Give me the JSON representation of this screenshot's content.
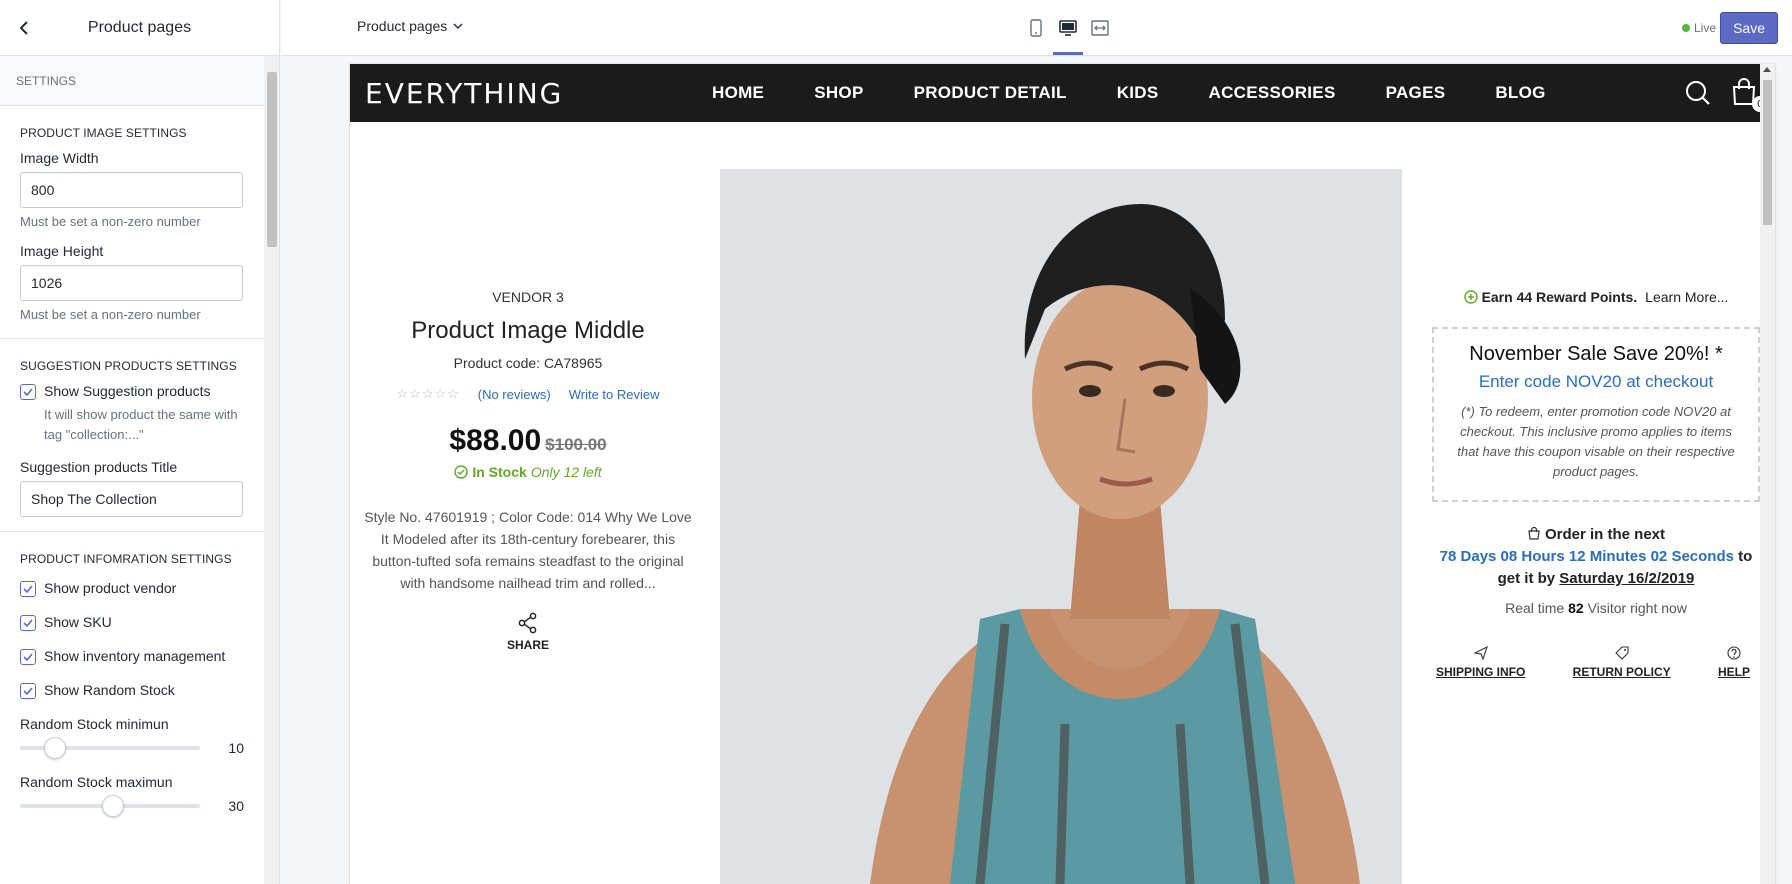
{
  "sidebar": {
    "title": "Product pages",
    "settings_label": "SETTINGS",
    "image_section": {
      "title": "PRODUCT IMAGE SETTINGS",
      "width_label": "Image Width",
      "width_value": "800",
      "width_help": "Must be set a non-zero number",
      "height_label": "Image Height",
      "height_value": "1026",
      "height_help": "Must be set a non-zero number"
    },
    "suggestion_section": {
      "title": "SUGGESTION PRODUCTS SETTINGS",
      "show_label": "Show Suggestion products",
      "show_checked": true,
      "show_help": "It will show product the same with tag \"collection:...\"",
      "title_label": "Suggestion products Title",
      "title_value": "Shop The Collection"
    },
    "info_section": {
      "title": "PRODUCT INFOMRATION SETTINGS",
      "checks": [
        {
          "label": "Show product vendor",
          "checked": true
        },
        {
          "label": "Show SKU",
          "checked": true
        },
        {
          "label": "Show inventory management",
          "checked": true
        },
        {
          "label": "Show Random Stock",
          "checked": true
        }
      ],
      "min_label": "Random Stock minimun",
      "min_value": "10",
      "min_fraction": 0.15,
      "max_label": "Random Stock maximun",
      "max_value": "30",
      "max_fraction": 0.52
    }
  },
  "topbar": {
    "page_selector": "Product pages",
    "devices": [
      "mobile-icon",
      "desktop-icon",
      "fullscreen-icon"
    ],
    "active_device": "desktop",
    "live_label": "Live",
    "save_label": "Save"
  },
  "store": {
    "logo": "EVERYTHING",
    "menu": [
      "HOME",
      "SHOP",
      "PRODUCT DETAIL",
      "KIDS",
      "ACCESSORIES",
      "PAGES",
      "BLOG"
    ],
    "cart_count": "0",
    "product": {
      "vendor": "VENDOR 3",
      "title": "Product Image Middle",
      "code": "Product code: CA78965",
      "reviews": "(No reviews)",
      "write_review": "Write to Review",
      "price": "$88.00",
      "compare_price": "$100.00",
      "in_stock": "In Stock",
      "stock_left": "Only 12 left",
      "description": "Style No. 47601919 ; Color Code: 014 Why We Love It Modeled after its 18th-century forebearer, this button-tufted sofa remains steadfast to the original with handsome nailhead trim and rolled...",
      "share": "SHARE"
    },
    "side": {
      "reward_bold": "Earn 44 Reward Points.",
      "reward_link": "Learn More...",
      "promo_title": "November Sale Save 20%! *",
      "promo_code": "Enter code NOV20 at checkout",
      "promo_note": "(*) To redeem, enter promotion code NOV20 at checkout. This inclusive promo applies to items that have this coupon visable on their respective product pages.",
      "order_prefix": "Order in the next",
      "countdown": "78 Days 08 Hours 12 Minutes 02 Seconds",
      "order_mid": "to get it by",
      "order_date": "Saturday 16/2/2019",
      "visitors_prefix": "Real time",
      "visitors_count": "82",
      "visitors_suffix": "Visitor right now",
      "policies": [
        "SHIPPING INFO",
        "RETURN POLICY",
        "HELP"
      ]
    }
  },
  "colors": {
    "accent": "#5c6ac4",
    "link": "#2a6ebb",
    "stock_green": "#62a72a",
    "nav_bg": "#1b1b1b"
  }
}
